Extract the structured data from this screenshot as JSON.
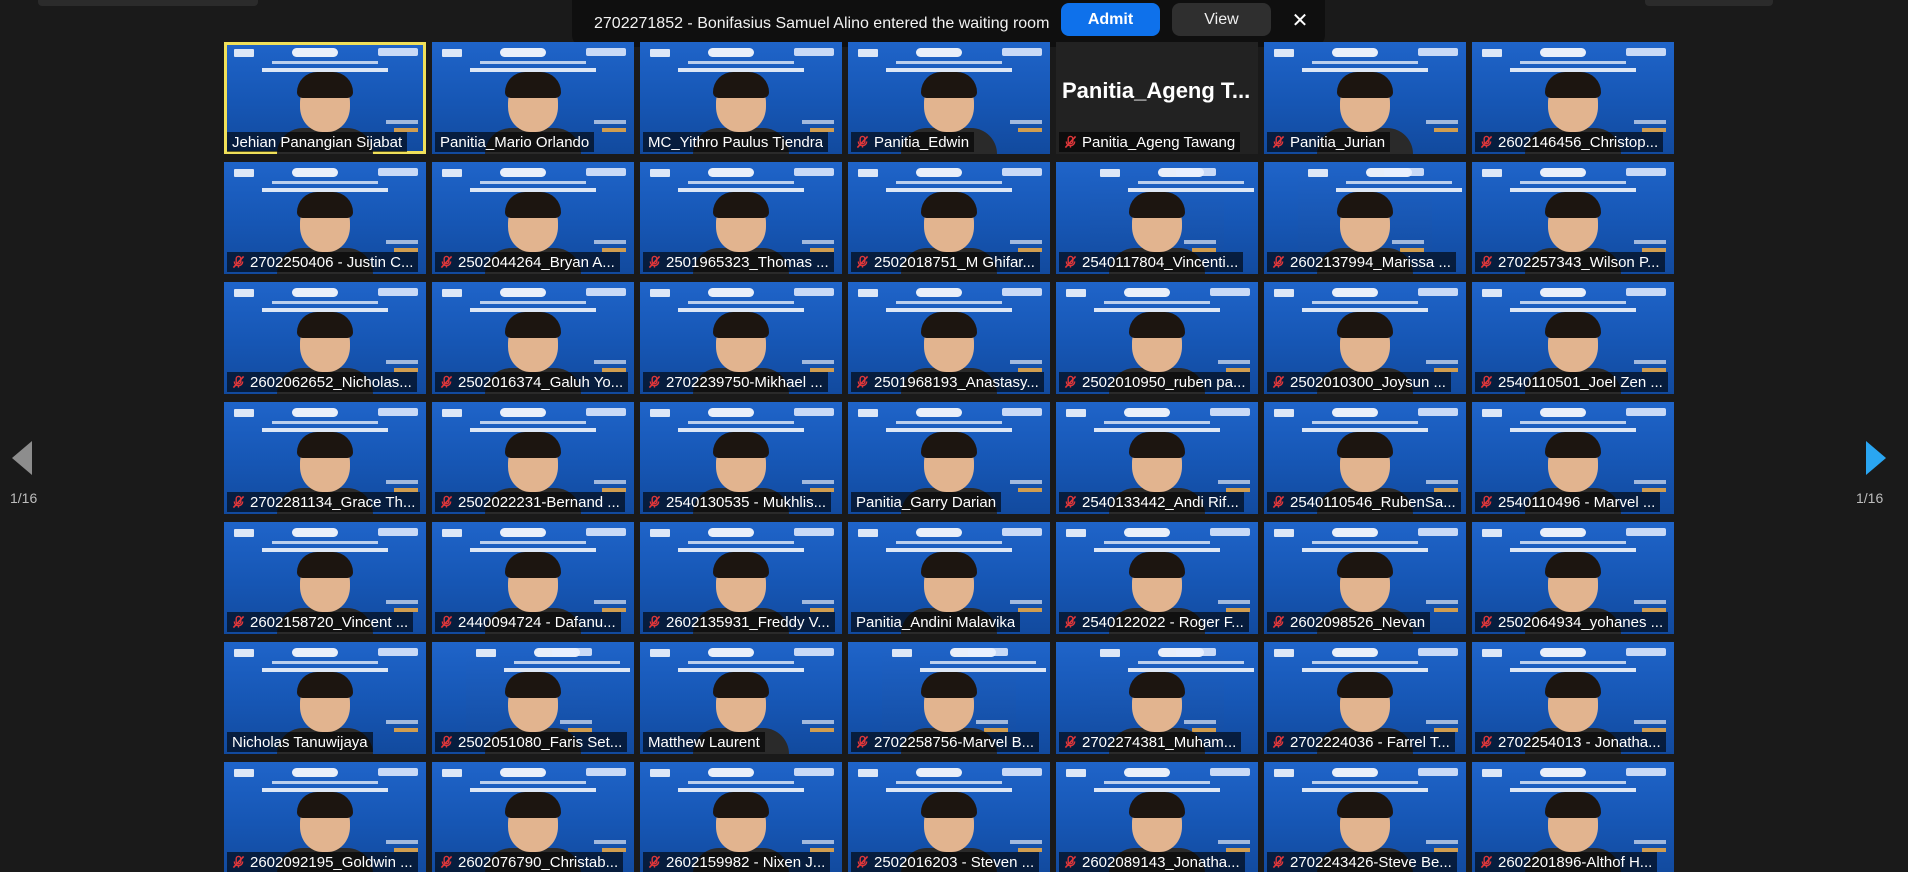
{
  "notification": {
    "message": "2702271852 - Bonifasius Samuel Alino entered the waiting room",
    "admit_label": "Admit",
    "view_label": "View",
    "close_label": "✕"
  },
  "pagination": {
    "left": "1/16",
    "right": "1/16"
  },
  "participants": [
    {
      "name": "Jehian Panangian Sijabat",
      "muted": false,
      "video": true,
      "active": true
    },
    {
      "name": "Panitia_Mario Orlando",
      "muted": false,
      "video": true
    },
    {
      "name": "MC_Yithro Paulus Tjendra",
      "muted": false,
      "video": true
    },
    {
      "name": "Panitia_Edwin",
      "muted": true,
      "video": true
    },
    {
      "name": "Panitia_Ageng Tawang",
      "muted": true,
      "video": false,
      "big_label": "Panitia_Ageng  T..."
    },
    {
      "name": "Panitia_Jurian",
      "muted": true,
      "video": true
    },
    {
      "name": "2602146456_Christop...",
      "muted": true,
      "video": true
    },
    {
      "name": "2702250406 - Justin C...",
      "muted": true,
      "video": true
    },
    {
      "name": "2502044264_Bryan A...",
      "muted": true,
      "video": true
    },
    {
      "name": "2501965323_Thomas ...",
      "muted": true,
      "video": true
    },
    {
      "name": "2502018751_M Ghifar...",
      "muted": true,
      "video": true
    },
    {
      "name": "2540117804_Vincenti...",
      "muted": true,
      "video": true,
      "dark": true
    },
    {
      "name": "2602137994_Marissa ...",
      "muted": true,
      "video": true,
      "dark": true
    },
    {
      "name": "2702257343_Wilson P...",
      "muted": true,
      "video": true
    },
    {
      "name": "2602062652_Nicholas...",
      "muted": true,
      "video": true
    },
    {
      "name": "2502016374_Galuh Yo...",
      "muted": true,
      "video": true
    },
    {
      "name": "2702239750-Mikhael ...",
      "muted": true,
      "video": true
    },
    {
      "name": "2501968193_Anastasy...",
      "muted": true,
      "video": true
    },
    {
      "name": "2502010950_ruben pa...",
      "muted": true,
      "video": true
    },
    {
      "name": "2502010300_Joysun ...",
      "muted": true,
      "video": true
    },
    {
      "name": "2540110501_Joel Zen ...",
      "muted": true,
      "video": true
    },
    {
      "name": "2702281134_Grace Th...",
      "muted": true,
      "video": true
    },
    {
      "name": "2502022231-Bernand ...",
      "muted": true,
      "video": true
    },
    {
      "name": "2540130535 - Mukhlis...",
      "muted": true,
      "video": true
    },
    {
      "name": "Panitia_Garry Darian",
      "muted": false,
      "video": true
    },
    {
      "name": "2540133442_Andi Rif...",
      "muted": true,
      "video": true
    },
    {
      "name": "2540110546_RubenSa...",
      "muted": true,
      "video": true
    },
    {
      "name": "2540110496 - Marvel ...",
      "muted": true,
      "video": true
    },
    {
      "name": "2602158720_Vincent ...",
      "muted": true,
      "video": true
    },
    {
      "name": "2440094724 - Dafanu...",
      "muted": true,
      "video": true
    },
    {
      "name": "2602135931_Freddy V...",
      "muted": true,
      "video": true
    },
    {
      "name": "Panitia_Andini Malavika",
      "muted": false,
      "video": true
    },
    {
      "name": "2540122022 - Roger F...",
      "muted": true,
      "video": true
    },
    {
      "name": "2602098526_Nevan",
      "muted": true,
      "video": true
    },
    {
      "name": "2502064934_yohanes ...",
      "muted": true,
      "video": true
    },
    {
      "name": "Nicholas Tanuwijaya",
      "muted": false,
      "video": true
    },
    {
      "name": "2502051080_Faris Set...",
      "muted": true,
      "video": true,
      "dark": true
    },
    {
      "name": "Matthew Laurent",
      "muted": false,
      "video": true
    },
    {
      "name": "2702258756-Marvel B...",
      "muted": true,
      "video": true,
      "dark": true
    },
    {
      "name": "2702274381_Muham...",
      "muted": true,
      "video": true,
      "dark": true
    },
    {
      "name": "2702224036 - Farrel T...",
      "muted": true,
      "video": true
    },
    {
      "name": "2702254013 - Jonatha...",
      "muted": true,
      "video": true
    },
    {
      "name": "2602092195_Goldwin ...",
      "muted": true,
      "video": true
    },
    {
      "name": "2602076790_Christab...",
      "muted": true,
      "video": true
    },
    {
      "name": "2602159982 - Nixen J...",
      "muted": true,
      "video": true
    },
    {
      "name": "2502016203 - Steven ...",
      "muted": true,
      "video": true
    },
    {
      "name": "2602089143_Jonatha...",
      "muted": true,
      "video": true
    },
    {
      "name": "2702243426-Steve Be...",
      "muted": true,
      "video": true
    },
    {
      "name": "2602201896-Althof H...",
      "muted": true,
      "video": true
    }
  ]
}
